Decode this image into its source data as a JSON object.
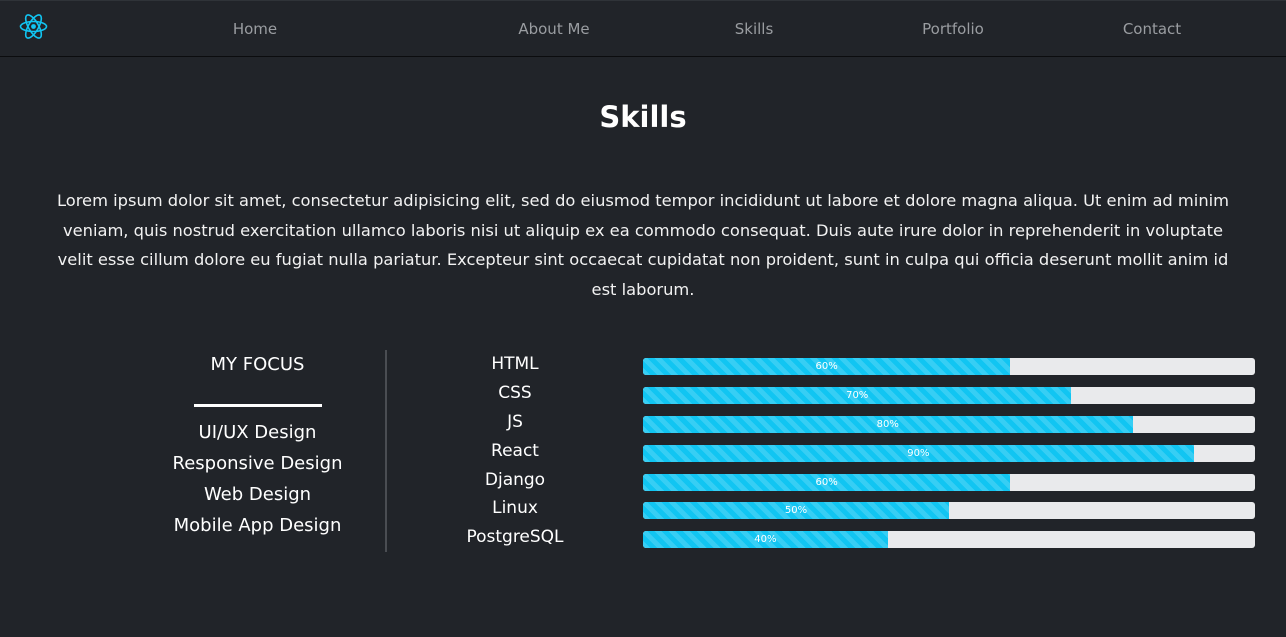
{
  "nav": {
    "links": [
      "Home",
      "About Me",
      "Skills",
      "Portfolio",
      "Contact"
    ],
    "logo_icon": "react-atom-icon"
  },
  "colors": {
    "background": "#212429",
    "accent": "#11c5f2",
    "nav_text": "#9a9da1",
    "bar_track": "#e9eaec"
  },
  "skills_section": {
    "title": "Skills",
    "intro": "Lorem ipsum dolor sit amet, consectetur adipisicing elit, sed do eiusmod tempor incididunt ut labore et dolore magna aliqua. Ut enim ad minim veniam, quis nostrud exercitation ullamco laboris nisi ut aliquip ex ea commodo consequat. Duis aute irure dolor in reprehenderit in voluptate velit esse cillum dolore eu fugiat nulla pariatur. Excepteur sint occaecat cupidatat non proident, sunt in culpa qui officia deserunt mollit anim id est laborum."
  },
  "focus": {
    "heading": "MY FOCUS",
    "items": [
      "UI/UX Design",
      "Responsive Design",
      "Web Design",
      "Mobile App Design"
    ]
  },
  "skills": [
    {
      "name": "HTML",
      "percent": 60,
      "label": "60%"
    },
    {
      "name": "CSS",
      "percent": 70,
      "label": "70%"
    },
    {
      "name": "JS",
      "percent": 80,
      "label": "80%"
    },
    {
      "name": "React",
      "percent": 90,
      "label": "90%"
    },
    {
      "name": "Django",
      "percent": 60,
      "label": "60%"
    },
    {
      "name": "Linux",
      "percent": 50,
      "label": "50%"
    },
    {
      "name": "PostgreSQL",
      "percent": 40,
      "label": "40%"
    }
  ]
}
